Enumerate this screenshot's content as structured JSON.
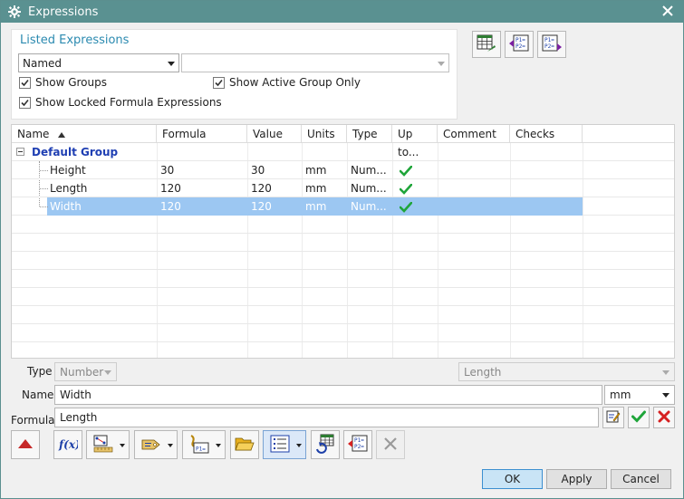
{
  "window": {
    "title": "Expressions",
    "gear_icon": "gear-icon",
    "close_icon": "close-icon"
  },
  "listed": {
    "title": "Listed Expressions",
    "filter_mode": "Named",
    "filter_text": "",
    "show_groups": {
      "label": "Show Groups",
      "checked": true
    },
    "show_active_group_only": {
      "label": "Show Active Group Only",
      "checked": true
    },
    "show_locked_formula": {
      "label": "Show Locked Formula Expressions",
      "checked": true
    }
  },
  "top_icons": [
    "spreadsheet-edit-icon",
    "import-expressions-icon",
    "export-expressions-icon"
  ],
  "table": {
    "columns": [
      "Name",
      "Formula",
      "Value",
      "Units",
      "Type",
      "Up to...",
      "Comment",
      "Checks"
    ],
    "group": "Default Group",
    "rows": [
      {
        "name": "Height",
        "formula": "30",
        "value": "30",
        "units": "mm",
        "type": "Num...",
        "uptodate": true,
        "comment": "",
        "checks": ""
      },
      {
        "name": "Length",
        "formula": "120",
        "value": "120",
        "units": "mm",
        "type": "Num...",
        "uptodate": true,
        "comment": "",
        "checks": ""
      },
      {
        "name": "Width",
        "formula": "120",
        "value": "120",
        "units": "mm",
        "type": "Num...",
        "uptodate": true,
        "comment": "",
        "checks": "",
        "selected": true
      }
    ]
  },
  "editor": {
    "type_label": "Type",
    "type_value": "Number",
    "dimension_value": "Length",
    "name_label": "Name",
    "name_value": "Width",
    "units_value": "mm",
    "formula_label": "Formula",
    "formula_value": "Length"
  },
  "buttons": {
    "ok": "OK",
    "apply": "Apply",
    "cancel": "Cancel"
  },
  "colors": {
    "titlebar": "#5a9191",
    "selection": "#9cc7f2",
    "group_text": "#1f3fb3",
    "listed_title": "#2b8ab0"
  }
}
